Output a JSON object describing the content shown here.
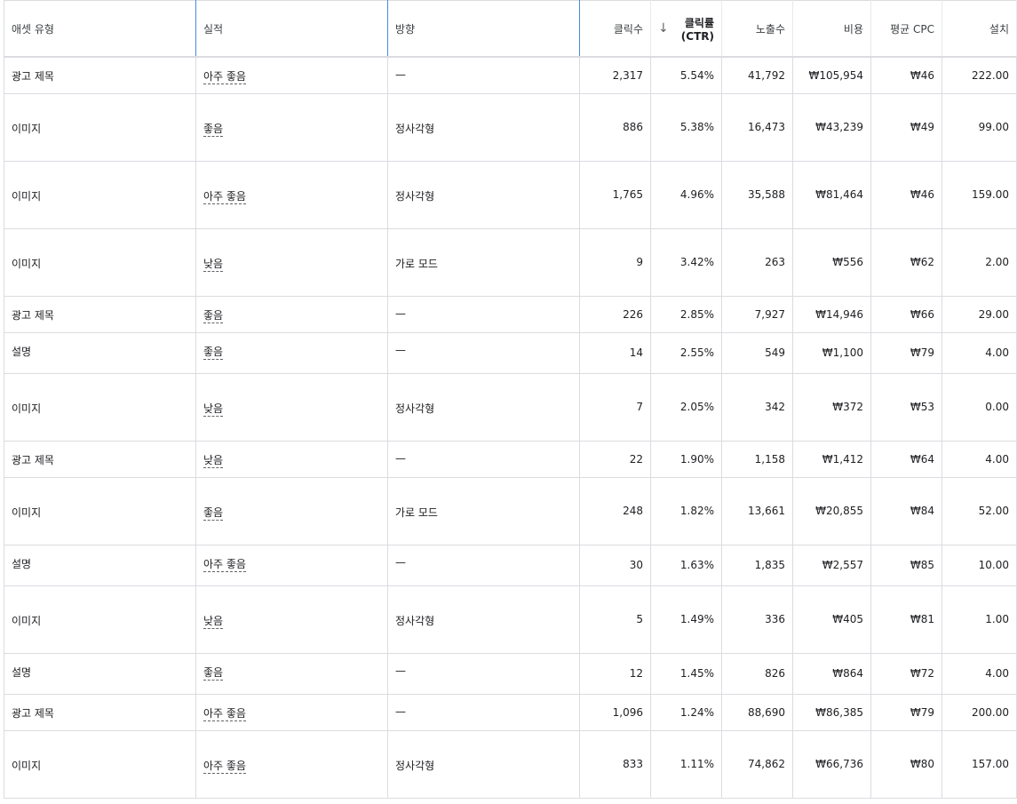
{
  "table": {
    "headers": [
      "애셋 유형",
      "실적",
      "방향",
      "클릭수",
      "클릭률 (CTR)",
      "노출수",
      "비용",
      "평균 CPC",
      "설치"
    ],
    "sort": {
      "column": 4,
      "direction": "desc",
      "icon": "arrow-down-icon",
      "glyph": "↓"
    },
    "rows": [
      {
        "type": "광고 제목",
        "perf": "아주 좋음",
        "orient": "—",
        "clicks": "2,317",
        "ctr": "5.54%",
        "impr": "41,792",
        "cost": "₩105,954",
        "cpc": "₩46",
        "installs": "222.00",
        "h": 41
      },
      {
        "type": "이미지",
        "perf": "좋음",
        "orient": "정사각형",
        "clicks": "886",
        "ctr": "5.38%",
        "impr": "16,473",
        "cost": "₩43,239",
        "cpc": "₩49",
        "installs": "99.00",
        "h": 76
      },
      {
        "type": "이미지",
        "perf": "아주 좋음",
        "orient": "정사각형",
        "clicks": "1,765",
        "ctr": "4.96%",
        "impr": "35,588",
        "cost": "₩81,464",
        "cpc": "₩46",
        "installs": "159.00",
        "h": 76
      },
      {
        "type": "이미지",
        "perf": "낮음",
        "orient": "가로 모드",
        "clicks": "9",
        "ctr": "3.42%",
        "impr": "263",
        "cost": "₩556",
        "cpc": "₩62",
        "installs": "2.00",
        "h": 76
      },
      {
        "type": "광고 제목",
        "perf": "좋음",
        "orient": "—",
        "clicks": "226",
        "ctr": "2.85%",
        "impr": "7,927",
        "cost": "₩14,946",
        "cpc": "₩66",
        "installs": "29.00",
        "h": 41
      },
      {
        "type": "설명",
        "perf": "좋음",
        "orient": "—",
        "clicks": "14",
        "ctr": "2.55%",
        "impr": "549",
        "cost": "₩1,100",
        "cpc": "₩79",
        "installs": "4.00",
        "h": 46
      },
      {
        "type": "이미지",
        "perf": "낮음",
        "orient": "정사각형",
        "clicks": "7",
        "ctr": "2.05%",
        "impr": "342",
        "cost": "₩372",
        "cpc": "₩53",
        "installs": "0.00",
        "h": 76
      },
      {
        "type": "광고 제목",
        "perf": "낮음",
        "orient": "—",
        "clicks": "22",
        "ctr": "1.90%",
        "impr": "1,158",
        "cost": "₩1,412",
        "cpc": "₩64",
        "installs": "4.00",
        "h": 41
      },
      {
        "type": "이미지",
        "perf": "좋음",
        "orient": "가로 모드",
        "clicks": "248",
        "ctr": "1.82%",
        "impr": "13,661",
        "cost": "₩20,855",
        "cpc": "₩84",
        "installs": "52.00",
        "h": 76
      },
      {
        "type": "설명",
        "perf": "아주 좋음",
        "orient": "—",
        "clicks": "30",
        "ctr": "1.63%",
        "impr": "1,835",
        "cost": "₩2,557",
        "cpc": "₩85",
        "installs": "10.00",
        "h": 46
      },
      {
        "type": "이미지",
        "perf": "낮음",
        "orient": "정사각형",
        "clicks": "5",
        "ctr": "1.49%",
        "impr": "336",
        "cost": "₩405",
        "cpc": "₩81",
        "installs": "1.00",
        "h": 76
      },
      {
        "type": "설명",
        "perf": "좋음",
        "orient": "—",
        "clicks": "12",
        "ctr": "1.45%",
        "impr": "826",
        "cost": "₩864",
        "cpc": "₩72",
        "installs": "4.00",
        "h": 46
      },
      {
        "type": "광고 제목",
        "perf": "아주 좋음",
        "orient": "—",
        "clicks": "1,096",
        "ctr": "1.24%",
        "impr": "88,690",
        "cost": "₩86,385",
        "cpc": "₩79",
        "installs": "200.00",
        "h": 41
      },
      {
        "type": "이미지",
        "perf": "아주 좋음",
        "orient": "정사각형",
        "clicks": "833",
        "ctr": "1.11%",
        "impr": "74,862",
        "cost": "₩66,736",
        "cpc": "₩80",
        "installs": "157.00",
        "h": 76
      }
    ]
  }
}
